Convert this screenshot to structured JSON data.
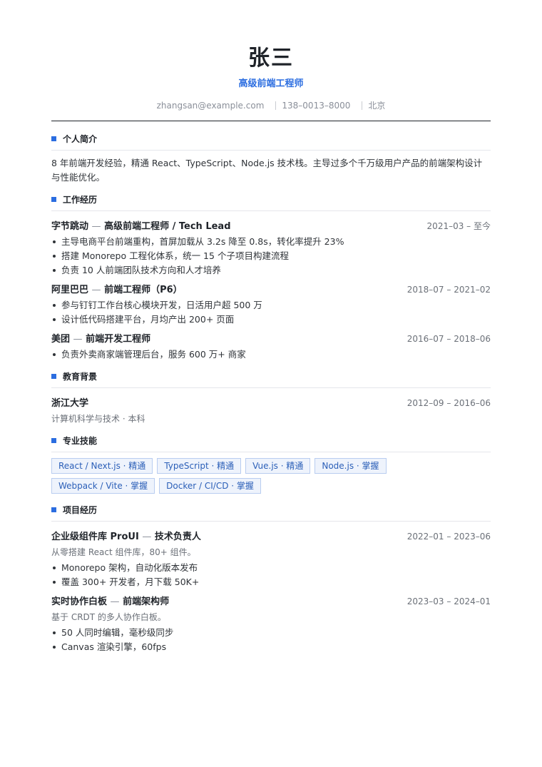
{
  "header": {
    "name": "张三",
    "title": "高级前端工程师",
    "email": "zhangsan@example.com",
    "phone": "138–0013–8000",
    "city": "北京"
  },
  "sections": {
    "summary": {
      "heading": "个人简介",
      "text": "8 年前端开发经验，精通 React、TypeScript、Node.js 技术栈。主导过多个千万级用户产品的前端架构设计与性能优化。"
    },
    "work": {
      "heading": "工作经历",
      "items": [
        {
          "company": "字节跳动",
          "role": "高级前端工程师 / Tech Lead",
          "date": "2021–03 – 至今",
          "bullets": [
            "主导电商平台前端重构，首屏加载从 3.2s 降至 0.8s，转化率提升 23%",
            "搭建 Monorepo 工程化体系，统一 15 个子项目构建流程",
            "负责 10 人前端团队技术方向和人才培养"
          ]
        },
        {
          "company": "阿里巴巴",
          "role": "前端工程师（P6）",
          "date": "2018–07 – 2021–02",
          "bullets": [
            "参与钉钉工作台核心模块开发，日活用户超 500 万",
            "设计低代码搭建平台，月均产出 200+ 页面"
          ]
        },
        {
          "company": "美团",
          "role": "前端开发工程师",
          "date": "2016–07 – 2018–06",
          "bullets": [
            "负责外卖商家端管理后台，服务 600 万+ 商家"
          ]
        }
      ]
    },
    "education": {
      "heading": "教育背景",
      "school": "浙江大学",
      "date": "2012–09 – 2016–06",
      "detail": "计算机科学与技术 · 本科"
    },
    "skills": {
      "heading": "专业技能",
      "items": [
        "React / Next.js · 精通",
        "TypeScript · 精通",
        "Vue.js · 精通",
        "Node.js · 掌握",
        "Webpack / Vite · 掌握",
        "Docker / CI/CD · 掌握"
      ]
    },
    "projects": {
      "heading": "项目经历",
      "items": [
        {
          "name": "企业级组件库 ProUI",
          "role": "技术负责人",
          "date": "2022–01 – 2023–06",
          "desc": "从零搭建 React 组件库，80+ 组件。",
          "bullets": [
            "Monorepo 架构，自动化版本发布",
            "覆盖 300+ 开发者，月下载 50K+"
          ]
        },
        {
          "name": "实时协作白板",
          "role": "前端架构师",
          "date": "2023–03 – 2024–01",
          "desc": "基于 CRDT 的多人协作白板。",
          "bullets": [
            "50 人同时编辑，毫秒级同步",
            "Canvas 渲染引擎，60fps"
          ]
        }
      ]
    }
  },
  "separator": "—",
  "colors": {
    "accent": "#2b6de0",
    "text": "#1f2329",
    "muted": "#6b7078"
  }
}
